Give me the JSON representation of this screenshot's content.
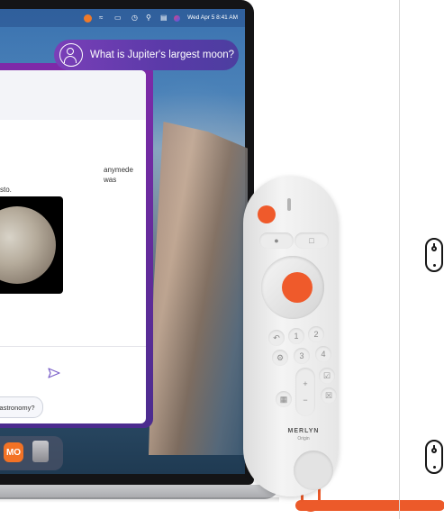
{
  "menubar": {
    "clock": "Wed Apr 5  8:41 AM",
    "icons": [
      "record-indicator-icon",
      "wifi-icon",
      "battery-icon",
      "clock-icon",
      "search-icon",
      "control-center-icon",
      "siri-icon"
    ]
  },
  "assistant": {
    "query": "What is Jupiter's largest moon?",
    "answer_line1": "anymede was",
    "answer_line2": "sto.",
    "suggestion_chip": "astronomy?"
  },
  "dock": {
    "app1_label": "MO"
  },
  "remote": {
    "brand": "MERLYN",
    "sub_brand": "Origin",
    "numbers": [
      "1",
      "2",
      "3",
      "4"
    ]
  },
  "colors": {
    "accent_orange": "#ef5a2b",
    "query_gradient_start": "#7a3fb8",
    "query_gradient_end": "#4c3ea0"
  }
}
